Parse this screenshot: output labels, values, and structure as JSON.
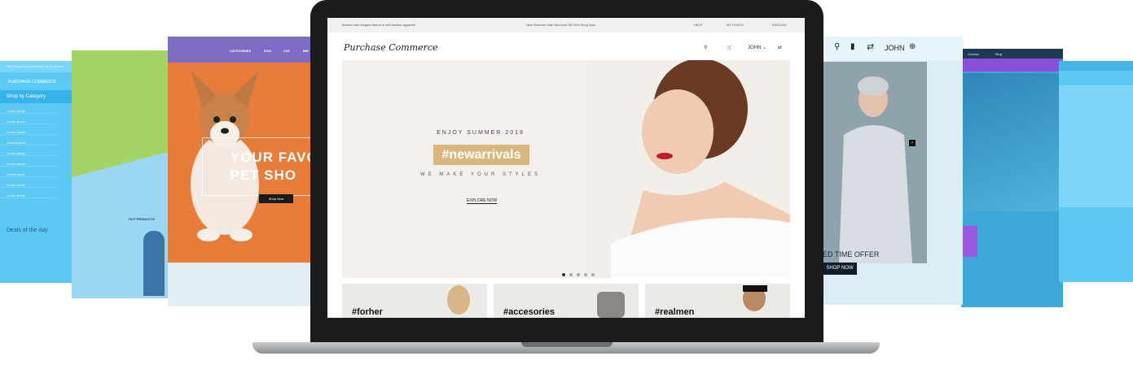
{
  "left_screen": {
    "topbar": "The Shopping Destination for Everyone",
    "logo": "PURCHASE COMMERCE",
    "category_label": "Shop by Category",
    "items": [
      "Lorem Ipsum",
      "Lorem Ipsum",
      "Lorem Ipsum",
      "Lorem Ipsum",
      "Lorem Ipsum",
      "Lorem Ipsum",
      "Lorem Ipsum",
      "Lorem Ipsum",
      "Lorem Ipsum"
    ],
    "deals": "Deals of the day"
  },
  "green_screen": {
    "hot_products": "HOT PRODUCTS"
  },
  "pet_screen": {
    "nav": [
      "CATEGORIES",
      "DOG",
      "CAT",
      "BIR"
    ],
    "headline_1": "YOUR FAVOU",
    "headline_2": "PET SHO",
    "shop_button": "Shop Now"
  },
  "main_screen": {
    "topbar_left": "Modern and elegant theme to sell fashion apparels",
    "topbar_center": "New Summer Sale Discount Off 50% Shop Now",
    "topbar_links": [
      "HELP",
      "MY CHECK",
      "ENGLISH"
    ],
    "brand": "Purchase Commerce",
    "user": "JOHN",
    "hero": {
      "eyebrow": "ENJOY SUMMER 2019",
      "hashtag": "#newarrivals",
      "tagline": "WE MAKE YOUR STYLES",
      "cta": "EXPLORE NOW"
    },
    "tiles": [
      "#forher",
      "#accesories",
      "#realmen"
    ]
  },
  "right_screen": {
    "user": "JOHN",
    "offer": "ED TIME OFFER",
    "shop_button": "SHOP NOW"
  },
  "purple_screen": {
    "nav": [
      "Contact",
      "Blog"
    ]
  },
  "colors": {
    "sky_blue": "#5cc9f5",
    "green": "#a4d465",
    "purple": "#7e6bc4",
    "orange": "#e77c3b",
    "gold": "#d9b77d",
    "laptop_body": "#1b1b1d"
  }
}
